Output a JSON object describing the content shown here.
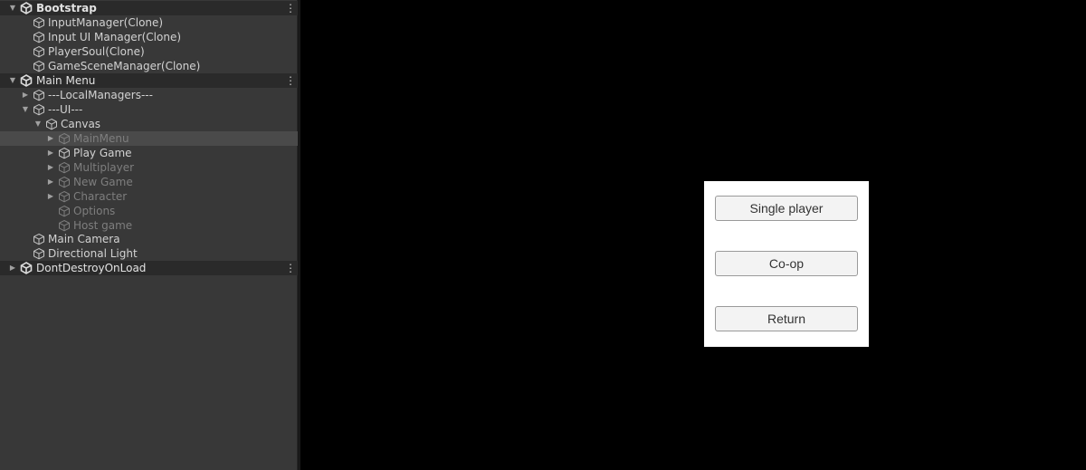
{
  "hierarchy": {
    "scenes": [
      {
        "name": "Bootstrap",
        "children": [
          "InputManager(Clone)",
          "Input UI Manager(Clone)",
          "PlayerSoul(Clone)",
          "GameSceneManager(Clone)"
        ]
      },
      {
        "name": "Main Menu",
        "local_managers": "---LocalManagers---",
        "ui": "---UI---",
        "canvas": "Canvas",
        "canvas_children": [
          "MainMenu",
          "Play Game",
          "Multiplayer",
          "New Game",
          "Character",
          "Options",
          "Host game"
        ],
        "after": [
          "Main Camera",
          "Directional Light"
        ]
      },
      {
        "name": "DontDestroyOnLoad"
      }
    ]
  },
  "game_view": {
    "menu_buttons": [
      "Single player",
      "Co-op",
      "Return"
    ]
  },
  "colors": {
    "panel_bg": "#383838",
    "scene_header_bg": "#2a2a2a",
    "selected_row_bg": "#4a4a4a",
    "inactive_text": "#7e7e7e",
    "game_bg": "#000000",
    "menu_panel_bg": "#ffffff",
    "button_bg": "#f3f3f3"
  },
  "icons": {
    "scene": "unity-scene-icon",
    "gameobject": "cube-icon",
    "menu": "kebab-menu-icon"
  }
}
